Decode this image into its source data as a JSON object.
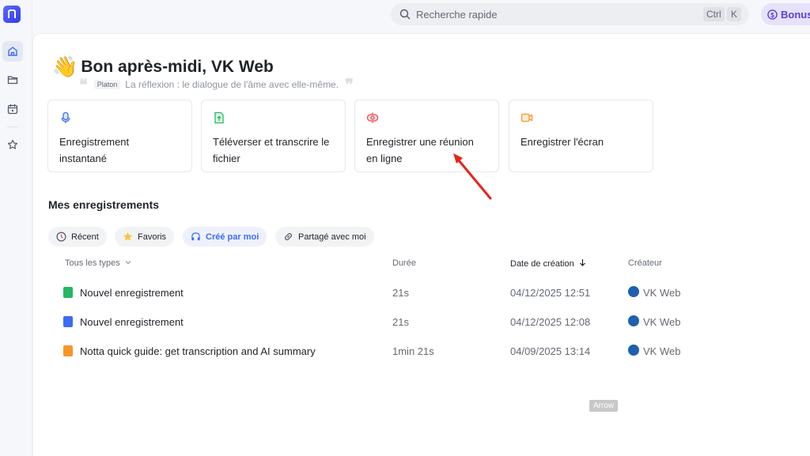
{
  "search": {
    "placeholder": "Recherche rapide",
    "kbd1": "Ctrl",
    "kbd2": "K"
  },
  "bonus": {
    "label": "Bonus"
  },
  "greeting": {
    "emoji": "👋",
    "title": "Bon après-midi, VK Web"
  },
  "quote": {
    "author": "Platon",
    "text": "La réflexion : le dialogue de l'âme avec elle-même."
  },
  "cards": [
    {
      "label_line1": "Enregistrement",
      "label_line2": "instantané",
      "icon": "mic-icon",
      "color": "#3b6cf6"
    },
    {
      "label_line1": "Téléverser et transcrire le",
      "label_line2": "fichier",
      "icon": "upload-file-icon",
      "color": "#25b864"
    },
    {
      "label_line1": "Enregistrer une réunion",
      "label_line2": "en ligne",
      "icon": "meeting-icon",
      "color": "#f0484e"
    },
    {
      "label_line1": "Enregistrer l'écran",
      "label_line2": "",
      "icon": "screen-record-icon",
      "color": "#f7962b"
    }
  ],
  "section": {
    "title": "Mes enregistrements"
  },
  "filters": [
    {
      "label": "Récent",
      "icon": "clock-icon"
    },
    {
      "label": "Favoris",
      "icon": "star-icon"
    },
    {
      "label": "Créé par moi",
      "icon": "headphones-icon"
    },
    {
      "label": "Partagé avec moi",
      "icon": "link-icon"
    }
  ],
  "table": {
    "headers": {
      "type": "Tous les types",
      "duration": "Durée",
      "date": "Date de création",
      "creator": "Créateur"
    },
    "rows": [
      {
        "name": "Nouvel enregistrement",
        "duration": "21s",
        "date": "04/12/2025 12:51",
        "creator": "VK Web",
        "type_color": "#25b864"
      },
      {
        "name": "Nouvel enregistrement",
        "duration": "21s",
        "date": "04/12/2025 12:08",
        "creator": "VK Web",
        "type_color": "#3b6cf6"
      },
      {
        "name": "Notta quick guide: get transcription and AI summary",
        "duration": "1min 21s",
        "date": "04/09/2025 13:14",
        "creator": "VK Web",
        "type_color": "#f7962b"
      }
    ]
  },
  "annotation": {
    "label": "Arrow"
  }
}
